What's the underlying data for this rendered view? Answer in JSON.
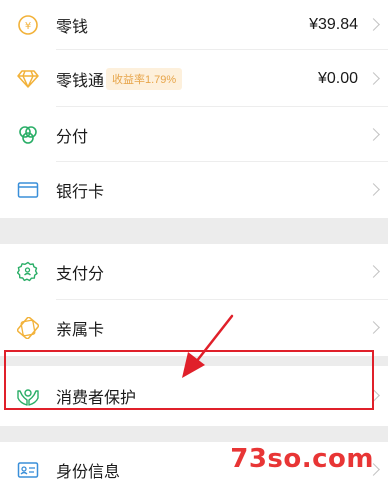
{
  "menu": {
    "change": {
      "label": "零钱",
      "value": "¥39.84",
      "icon": "coin-yen-icon"
    },
    "change_plus": {
      "label": "零钱通",
      "badge": "收益率1.79%",
      "value": "¥0.00",
      "icon": "diamond-icon"
    },
    "fenfu": {
      "label": "分付",
      "icon": "clover-icon"
    },
    "bank_card": {
      "label": "银行卡",
      "icon": "card-icon"
    },
    "pay_score": {
      "label": "支付分",
      "icon": "score-badge-icon"
    },
    "family_card": {
      "label": "亲属卡",
      "icon": "family-card-icon"
    },
    "consumer_protect": {
      "label": "消费者保护",
      "icon": "hands-protect-icon"
    },
    "identity": {
      "label": "身份信息",
      "icon": "id-card-icon"
    }
  },
  "watermark": "73so.com",
  "colors": {
    "accent_green": "#2aae67",
    "accent_orange": "#f2b23a",
    "annotation_red": "#e0202a"
  }
}
